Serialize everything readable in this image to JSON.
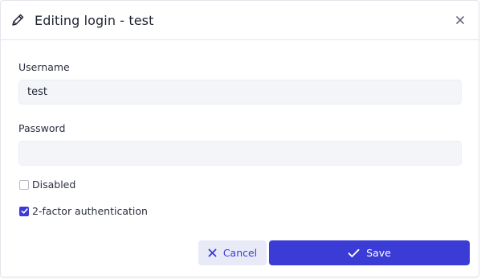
{
  "dialog": {
    "title": "Editing login - test",
    "title_icon": "pencil-icon",
    "close_icon": "close-icon"
  },
  "form": {
    "username_label": "Username",
    "username_value": "test",
    "password_label": "Password",
    "password_value": "",
    "disabled_label": "Disabled",
    "disabled_checked": false,
    "twofa_label": "2-factor authentication",
    "twofa_checked": true
  },
  "actions": {
    "cancel_label": "Cancel",
    "cancel_icon": "x-icon",
    "save_label": "Save",
    "save_icon": "checkmark-icon"
  },
  "colors": {
    "accent": "#3b3bd6",
    "cancel_bg": "#e9eaf8",
    "input_bg": "#f4f5f9"
  }
}
